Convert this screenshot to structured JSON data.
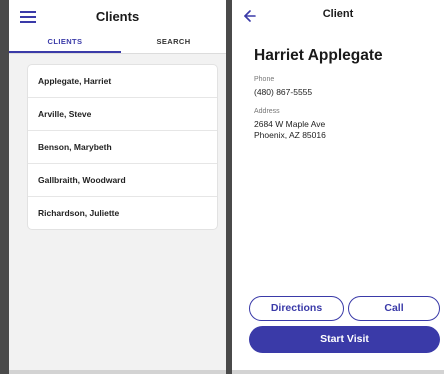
{
  "clients_screen": {
    "title": "Clients",
    "tabs": [
      {
        "label": "CLIENTS",
        "active": true
      },
      {
        "label": "SEARCH",
        "active": false
      }
    ],
    "clients": [
      "Applegate, Harriet",
      "Arville, Steve",
      "Benson, Marybeth",
      "Gallbraith, Woodward",
      "Richardson, Juliette"
    ]
  },
  "client_screen": {
    "title": "Client",
    "name": "Harriet Applegate",
    "phone_label": "Phone",
    "phone": "(480) 867-5555",
    "address_label": "Address",
    "address_line1": "2684 W Maple Ave",
    "address_line2": "Phoenix, AZ 85016",
    "directions_label": "Directions",
    "call_label": "Call",
    "start_visit_label": "Start Visit"
  },
  "colors": {
    "accent": "#3a3aa8",
    "background_dark": "#4a4a4a",
    "list_background": "#f2f2f2"
  },
  "icons": {
    "menu": "menu-icon",
    "back": "back-arrow-icon"
  }
}
